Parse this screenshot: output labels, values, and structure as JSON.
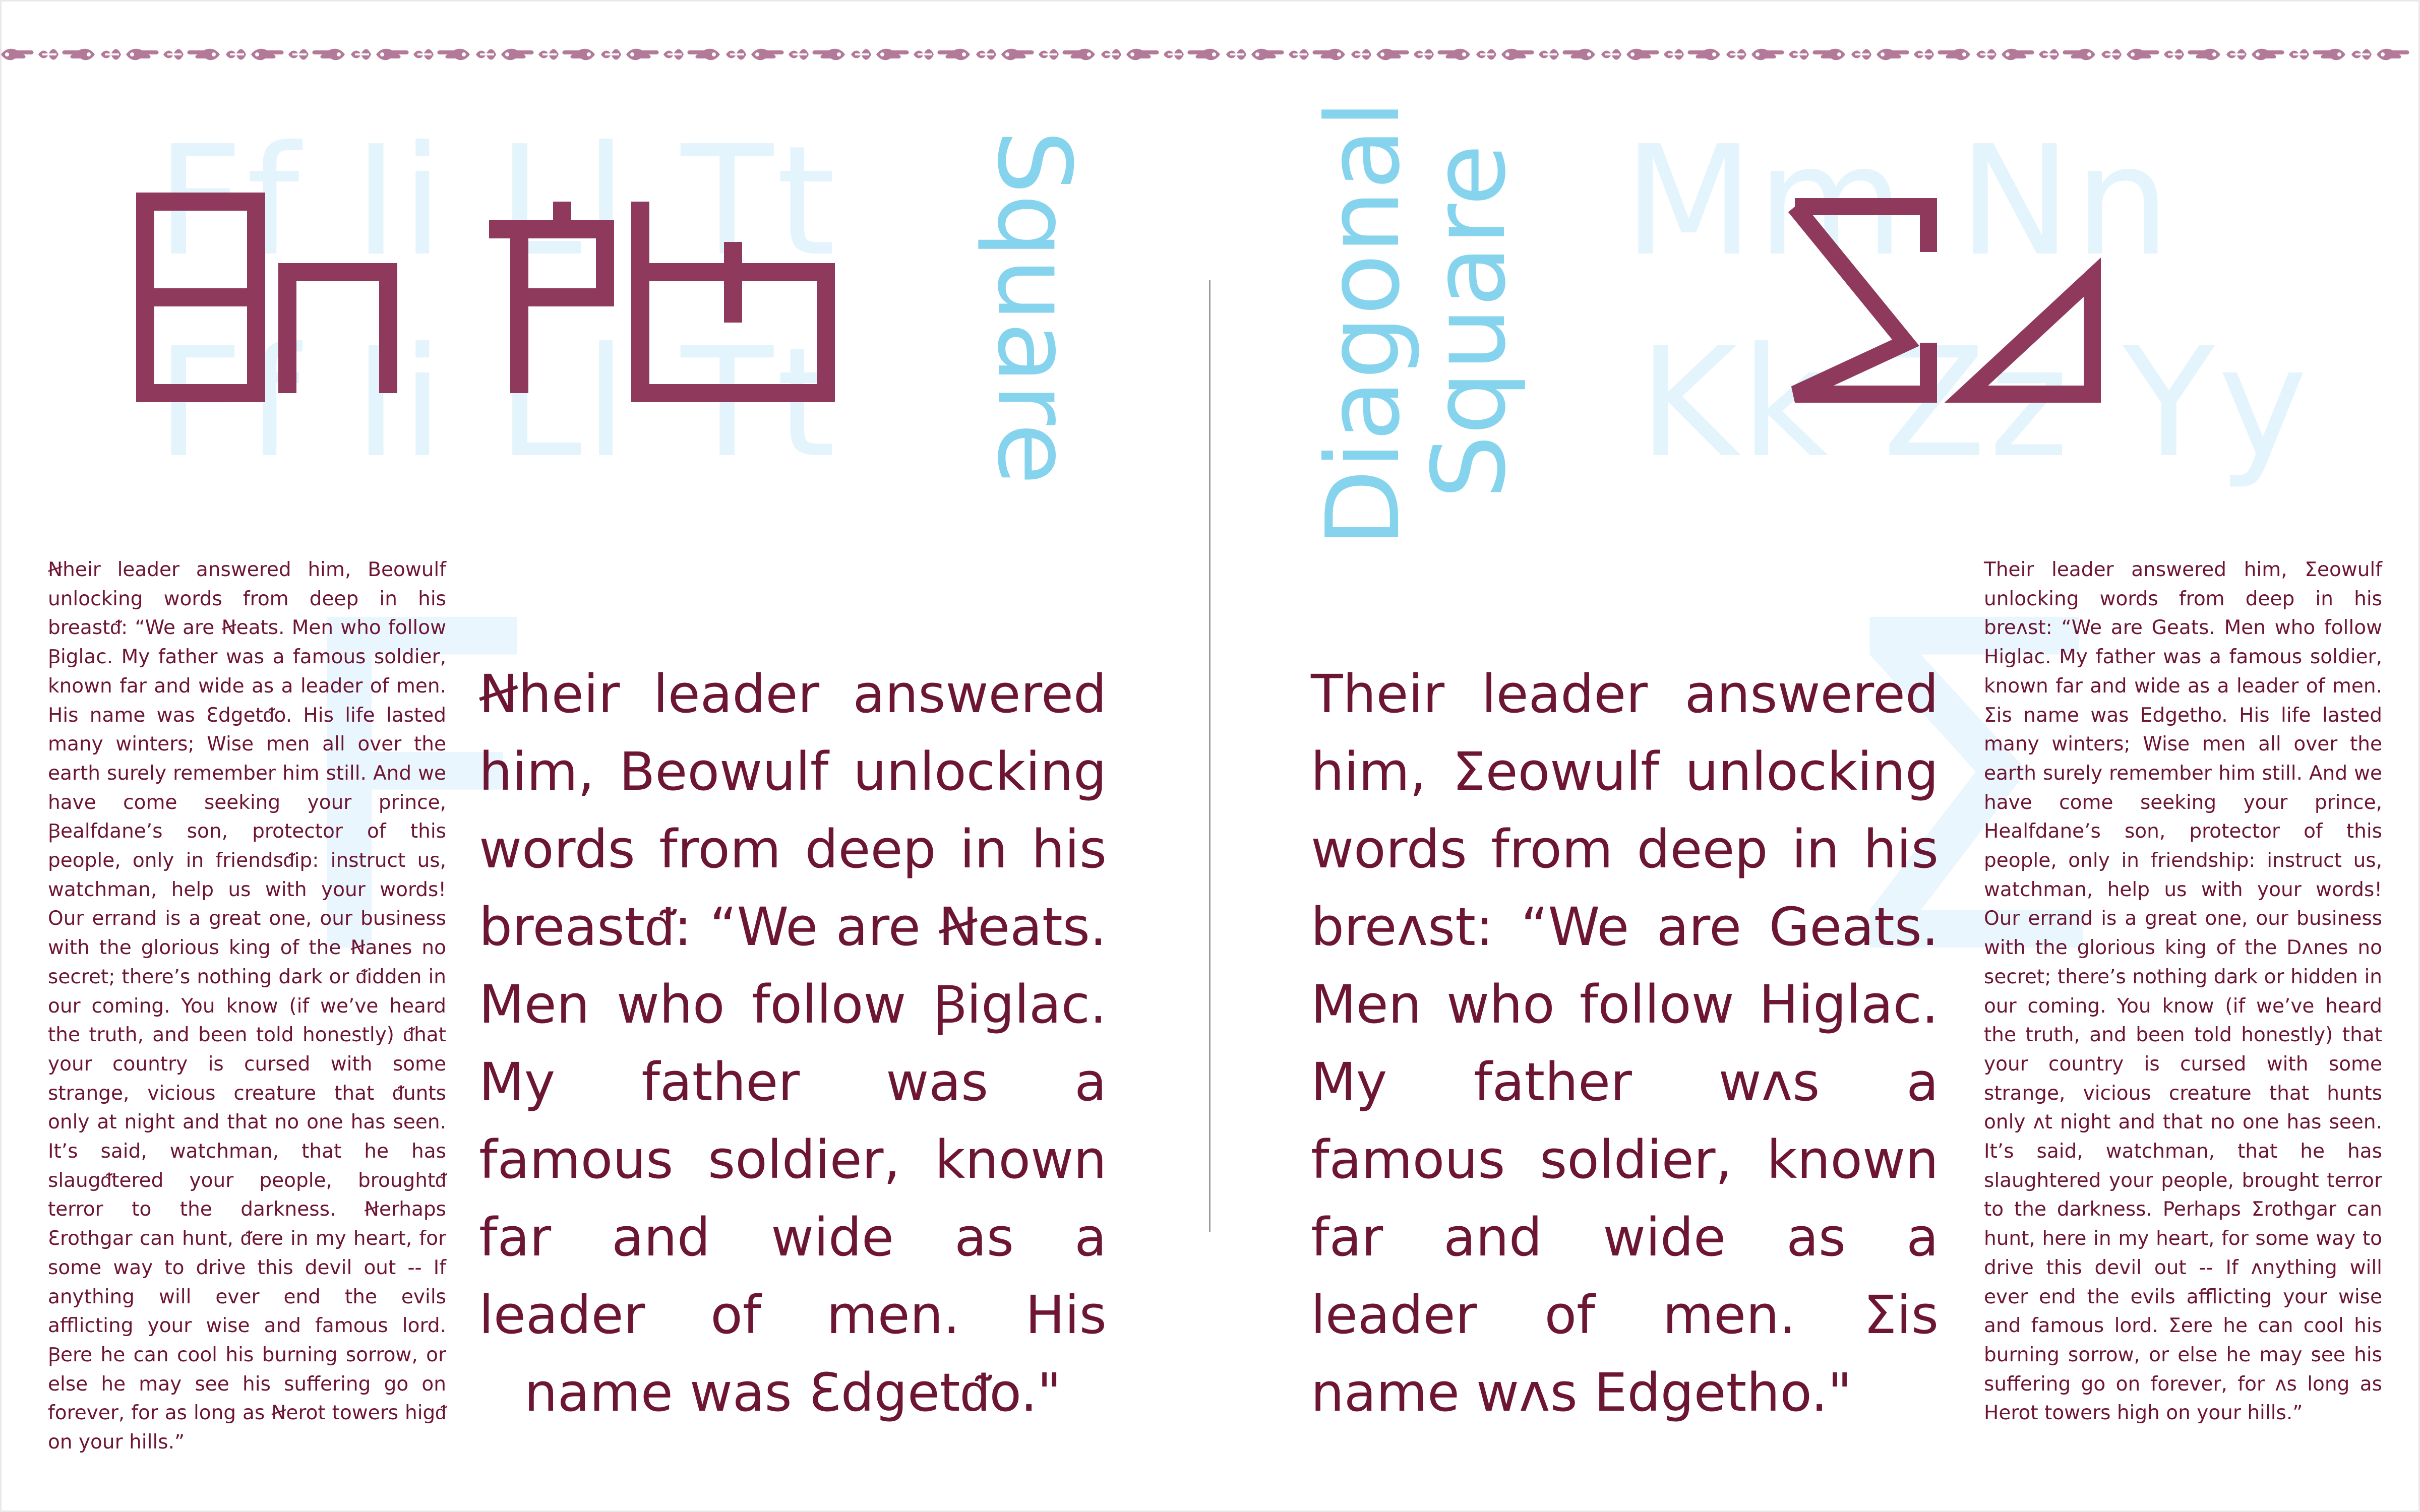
{
  "headings": {
    "left": "Square",
    "right_line1": "Diagonal",
    "right_line2": "Square"
  },
  "ghost_letters": {
    "left_row1": "Ff Ii Ll Tt",
    "left_row2": "Ff Ii Ll Tt",
    "right_row1": "Mm Nn",
    "right_row2": "Kk Zz Yy",
    "left_big": "F",
    "right_big": "Σ"
  },
  "small_text": {
    "left": "Ꞥheir leader answered him, Beowulf unlocking words from deep in his breastᵭ: “We are Ꞥeats. Men who follow Ꞵiglac. My father was a famous soldier, known far and wide as a leader of men. His name was Ɛdgetᵭo. His life lasted many winters; Wise men all over the earth surely remember him still. And we have come seeking your prince, Ꞵealfdane’s son, protector of this people, only in friendsᵭip: instruct us, watchman, help us with your words! Our errand is a great one, our business with the glorious king of the Ꞥanes no secret; there’s nothing dark or ᵭidden in our coming. You know (if we’ve heard the truth, and been told honestly) ᵭhat your country is cursed with some strange, vicious creature that ᵭunts only at night and that no one has seen. It’s said, watchman, that he has slaugᵭtered your people, broughtᵭ terror to the darkness. Ꞥerhaps Ɛrothgar can hunt, ᵭere in my heart, for some way to drive this devil out -- If anything will ever end the evils afflicting your wise and famous lord. Ꞵere he can cool his burning sorrow, or else he may see his suffering go on forever, for as long as Ꞥerot towers higᵭ on your hills.”",
    "right": "Their leader answered him, Ʃeowulf unlocking words from deep in his breᴧst: “We are Geats. Men who follow Higlac. My father was a famous soldier, known far and wide as a leader of men. Ʃis name was Edgetho. His life lasted many winters; Wise men all over the earth surely remember him still. And we have come seeking your prince, Healfdane’s son, protector of this people, only in friendship: instruct us, watchman, help us with your words! Our errand is a great one, our business with the glorious king of the Dᴧnes no secret; there’s nothing dark or hidden in our coming. You know (if we’ve heard the truth, and been told honestly) that your country is cursed with some strange, vicious creature that hunts only ᴧt night and that no one has seen. It’s said, watchman, that he has slaughtered your people, brought terror to the darkness. Perhaps Ʃrothgar can hunt, here in my heart, for some way to drive this devil out -- If ᴧnything will ever end the evils afflicting your wise and famous lord. Ʃere he can cool his burning sorrow, or else he may see his suffering go on forever, for ᴧs long as Herot towers high on your hills.”"
  },
  "big_text": {
    "left": "Ꞥheir leader answered him, Beowulf unlocking words from deep in his breastᵭ: “We are Ꞥeats. Men who follow Ꞵiglac. My father was a famous soldier, known far and wide as a leader of men. His name was Ɛdgetᵭo.\"",
    "right": "Their leader answered him, Ʃeowulf unlocking words from deep in his breᴧst: “We are Geats. Men who follow Higlac. My father wᴧs a famous soldier, known far and wide as a leader of men. Ʃis name wᴧs Edgetho.\""
  },
  "colors": {
    "text": "#6d1634",
    "glyph": "#8f3a5c",
    "heading": "#86d3ee",
    "ghost": "#e3f4fc",
    "ornament": "#b27a98",
    "divider": "#9a9a9a"
  },
  "icons": [
    "pointing-hand-ornament-icon",
    "fleuron-ornament-icon"
  ]
}
